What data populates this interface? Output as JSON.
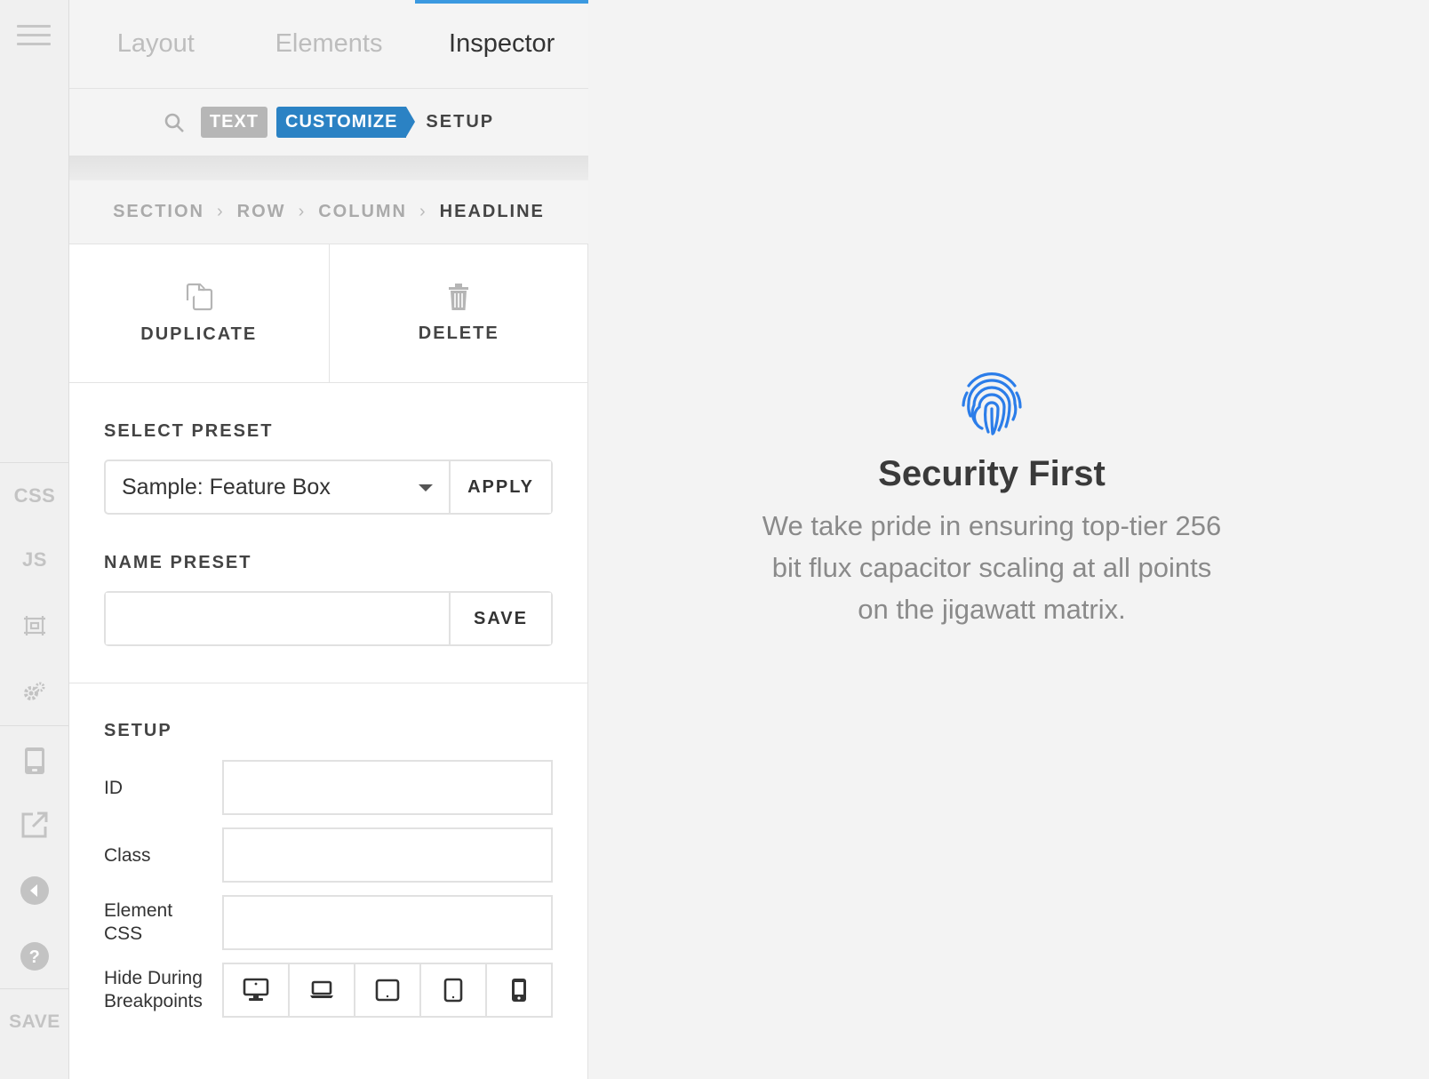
{
  "rail": {
    "menu_icon": "hamburger-icon",
    "css_label": "CSS",
    "js_label": "JS",
    "save_label": "SAVE",
    "icons": [
      "frame-icon",
      "gears-icon",
      "tablet-icon",
      "external-link-icon",
      "back-icon",
      "help-icon"
    ]
  },
  "tabs": [
    {
      "label": "Layout"
    },
    {
      "label": "Elements"
    },
    {
      "label": "Inspector"
    }
  ],
  "subnav": {
    "search_icon": "search-icon",
    "text": "TEXT",
    "customize": "CUSTOMIZE",
    "setup": "SETUP"
  },
  "breadcrumb": [
    "SECTION",
    "ROW",
    "COLUMN",
    "HEADLINE"
  ],
  "actions": {
    "duplicate": "DUPLICATE",
    "delete": "DELETE"
  },
  "preset": {
    "select_label": "SELECT PRESET",
    "selected": "Sample: Feature Box",
    "apply": "APPLY",
    "name_label": "NAME PRESET",
    "name_value": "",
    "save": "SAVE"
  },
  "setup": {
    "heading": "SETUP",
    "id_label": "ID",
    "id_value": "",
    "class_label": "Class",
    "class_value": "",
    "css_label_1": "Element",
    "css_label_2": "CSS",
    "css_value": "",
    "hide_label_1": "Hide During",
    "hide_label_2": "Breakpoints",
    "breakpoints": [
      "desktop-icon",
      "laptop-icon",
      "tablet-landscape-icon",
      "tablet-portrait-icon",
      "phone-icon"
    ]
  },
  "feature": {
    "icon": "fingerprint-icon",
    "title": "Security First",
    "body_1": "We take pride in ensuring top-tier 256",
    "body_2": "bit flux capacitor scaling at all points",
    "body_3": "on the jigawatt matrix."
  },
  "colors": {
    "accent": "#3b99e0",
    "customize_pill": "#2b82c4",
    "text_pill": "#b6b6b6",
    "fingerprint": "#2b7de9"
  }
}
